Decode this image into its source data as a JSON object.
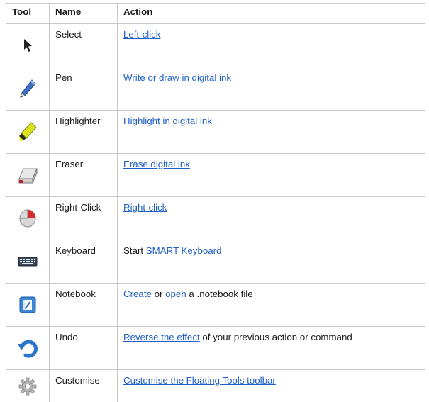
{
  "headers": {
    "tool": "Tool",
    "name": "Name",
    "action": "Action"
  },
  "rows": [
    {
      "icon": "cursor-arrow-icon",
      "name": "Select",
      "action": [
        {
          "text": "Left-click",
          "link": true
        }
      ]
    },
    {
      "icon": "pen-icon",
      "name": "Pen",
      "action": [
        {
          "text": "Write or draw in digital ink",
          "link": true
        }
      ]
    },
    {
      "icon": "highlighter-icon",
      "name": "Highlighter",
      "action": [
        {
          "text": "Highlight in digital ink",
          "link": true
        }
      ]
    },
    {
      "icon": "eraser-icon",
      "name": "Eraser",
      "action": [
        {
          "text": "Erase digital ink",
          "link": true
        }
      ]
    },
    {
      "icon": "mouse-right-click-icon",
      "name": "Right-Click",
      "action": [
        {
          "text": "Right-click",
          "link": true
        }
      ]
    },
    {
      "icon": "keyboard-icon",
      "name": "Keyboard",
      "action": [
        {
          "text": "Start ",
          "link": false
        },
        {
          "text": "SMART Keyboard",
          "link": true
        }
      ]
    },
    {
      "icon": "notebook-icon",
      "name": "Notebook",
      "action": [
        {
          "text": "Create",
          "link": true
        },
        {
          "text": " or ",
          "link": false
        },
        {
          "text": "open",
          "link": true
        },
        {
          "text": " a .notebook file",
          "link": false
        }
      ]
    },
    {
      "icon": "undo-icon",
      "name": "Undo",
      "action": [
        {
          "text": "Reverse the effect",
          "link": true
        },
        {
          "text": " of your previous action or command",
          "link": false
        }
      ]
    },
    {
      "icon": "gear-icon",
      "name": "Customise",
      "action": [
        {
          "text": "Customise the Floating Tools toolbar",
          "link": true
        }
      ]
    }
  ],
  "colors": {
    "link": "#1f5fc6",
    "border": "#c8c8c8",
    "text": "#1a1a1a"
  }
}
